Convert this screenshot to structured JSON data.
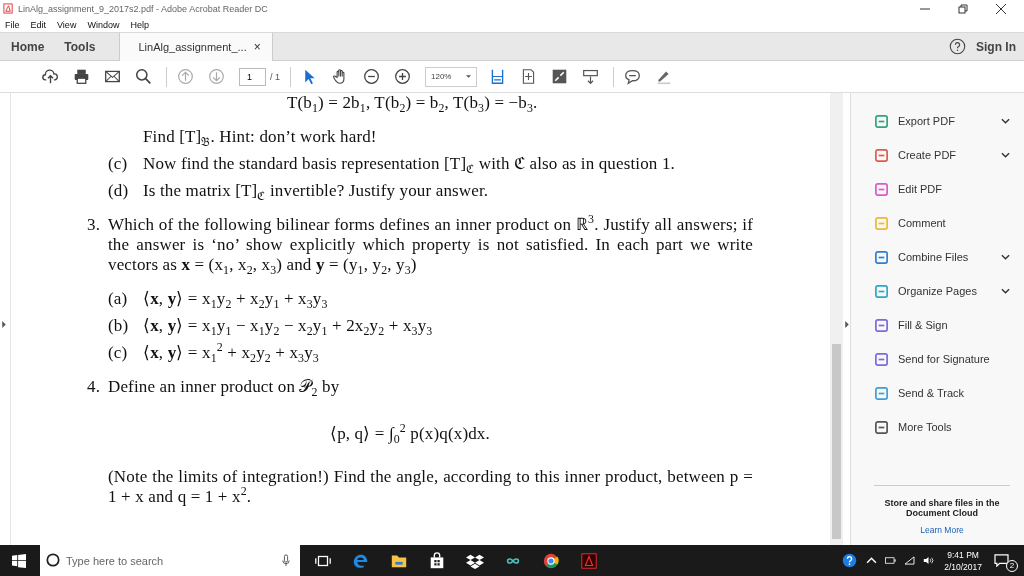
{
  "window": {
    "title": "LinAlg_assignment_9_2017s2.pdf - Adobe Acrobat Reader DC"
  },
  "menu": [
    "File",
    "Edit",
    "View",
    "Window",
    "Help"
  ],
  "tabs": [
    {
      "label": "Home",
      "kind": "nav",
      "selected": false
    },
    {
      "label": "Tools",
      "kind": "nav",
      "selected": false
    },
    {
      "label": "LinAlg_assignment_...",
      "kind": "document",
      "selected": true,
      "close": "×"
    }
  ],
  "sign_in": "Sign In",
  "toolbar": {
    "page": "1",
    "page_total": "/ 1",
    "zoom": "120%"
  },
  "document": {
    "lines": [
      {
        "kind": "cut",
        "text": "T(b$_{1}$) = 2b$_{1}$,  T(b$_{2}$) = b$_{2}$,  T(b$_{3}$) = −b$_{3}$."
      },
      {
        "kind": "para",
        "text": "Find [T]$_{𝔅}$. Hint: don’t work hard!"
      },
      {
        "kind": "part",
        "label": "(c)",
        "text": "Now find the standard basis representation [T]$_{ℭ}$ with ℭ also as in question 1."
      },
      {
        "kind": "part",
        "label": "(d)",
        "text": "Is the matrix [T]$_{ℭ}$ invertible? Justify your answer."
      },
      {
        "kind": "question",
        "label": "3.",
        "text": "Which of the following bilinear forms defines an inner product on ℝ$^{3}$. Justify all answers; if the answer is ‘no’ show explicitly which property is not satisfied. In each part we write vectors as **x** = (x$_{1}$, x$_{2}$, x$_{3}$) and **y** = (y$_{1}$, y$_{2}$, y$_{3}$)"
      },
      {
        "kind": "part",
        "label": "(a)",
        "text": "⟨**x**, **y**⟩ = x$_{1}$y$_{2}$ + x$_{2}$y$_{1}$ + x$_{3}$y$_{3}$"
      },
      {
        "kind": "part",
        "label": "(b)",
        "text": "⟨**x**, **y**⟩ = x$_{1}$y$_{1}$ − x$_{1}$y$_{2}$ − x$_{2}$y$_{1}$ + 2x$_{2}$y$_{2}$ + x$_{3}$y$_{3}$"
      },
      {
        "kind": "part",
        "label": "(c)",
        "text": "⟨**x**, **y**⟩ = x$_{1}$$^{2}$ + x$_{2}$y$_{2}$ + x$_{3}$y$_{3}$"
      },
      {
        "kind": "question",
        "label": "4.",
        "text": "Define an inner product on 𝒫$_{2}$ by"
      },
      {
        "kind": "display",
        "text": "⟨p, q⟩ = ∫$_{0}$$^{2}$ p(x)q(x)dx."
      },
      {
        "kind": "para",
        "text": "(Note the limits of integration!)  Find the angle, according to this inner product, between p = 1 + x and q = 1 + x$^{2}$."
      }
    ]
  },
  "tools": [
    {
      "label": "Export PDF",
      "color": "#2fa37c",
      "expandable": true
    },
    {
      "label": "Create PDF",
      "color": "#e05a4b",
      "expandable": true
    },
    {
      "label": "Edit PDF",
      "color": "#e055c8",
      "expandable": false
    },
    {
      "label": "Comment",
      "color": "#f2b823",
      "expandable": false
    },
    {
      "label": "Combine Files",
      "color": "#2c7fd6",
      "expandable": true
    },
    {
      "label": "Organize Pages",
      "color": "#29a8c9",
      "expandable": true
    },
    {
      "label": "Fill & Sign",
      "color": "#7a6ae0",
      "expandable": false
    },
    {
      "label": "Send for Signature",
      "color": "#7a6ae0",
      "expandable": false
    },
    {
      "label": "Send & Track",
      "color": "#3b9fd8",
      "expandable": false
    },
    {
      "label": "More Tools",
      "color": "#555555",
      "expandable": false
    }
  ],
  "cloud": {
    "text": "Store and share files in the Document Cloud",
    "link": "Learn More"
  },
  "taskbar": {
    "search_placeholder": "Type here to search",
    "time": "9:41 PM",
    "date": "2/10/2017",
    "notifications": "2"
  }
}
